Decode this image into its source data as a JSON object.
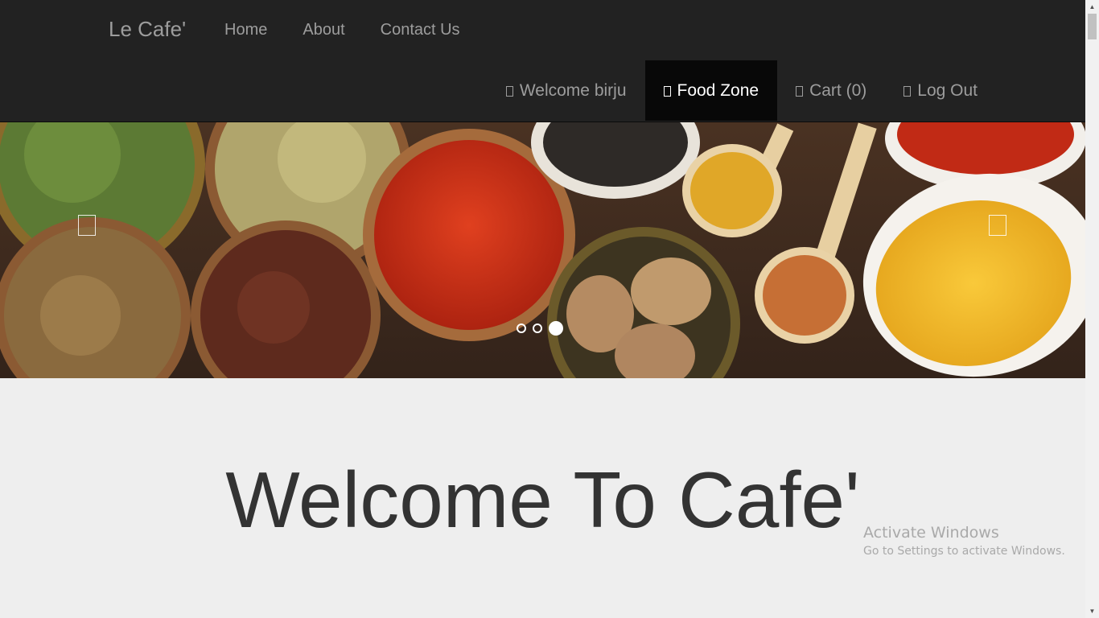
{
  "brand": "Le Cafe'",
  "nav_left": [
    "Home",
    "About",
    "Contact Us"
  ],
  "nav_right": [
    {
      "label": "Welcome birju",
      "icon": "user-icon",
      "active": false
    },
    {
      "label": "Food Zone",
      "icon": "cutlery-icon",
      "active": true
    },
    {
      "label": "Cart (0)",
      "icon": "cart-icon",
      "active": false
    },
    {
      "label": "Log Out",
      "icon": "logout-icon",
      "active": false
    }
  ],
  "carousel": {
    "slide_count": 3,
    "active_slide": 3,
    "controls": {
      "prev": "chevron-left-icon",
      "next": "chevron-right-icon"
    }
  },
  "main": {
    "heading": "Welcome To Cafe'"
  },
  "watermark": {
    "title": "Activate Windows",
    "subtitle": "Go to Settings to activate Windows."
  },
  "colors": {
    "navbar_bg": "#222222",
    "nav_text": "#9d9d9d",
    "active_bg": "#080808",
    "page_bg": "#eeeeee",
    "heading": "#333333"
  }
}
